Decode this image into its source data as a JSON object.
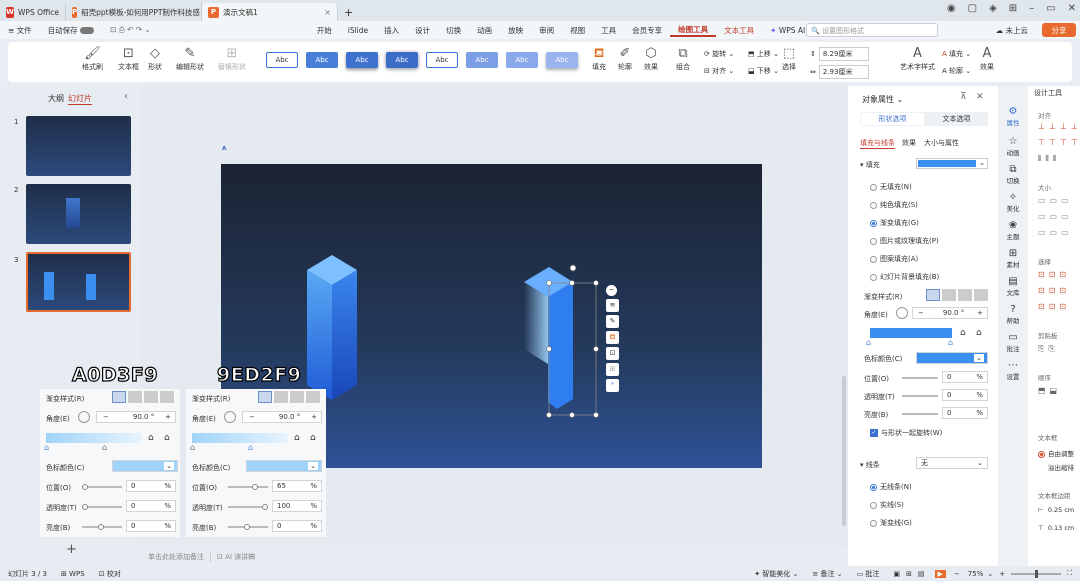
{
  "titlebar": {
    "tabs": [
      {
        "label": "WPS Office",
        "logo": "W",
        "color": "#d9342b"
      },
      {
        "label": "稻壳ppt模板-如何用PPT制作科技感",
        "logo": "P",
        "color": "#e86a2e"
      },
      {
        "label": "演示文稿1",
        "logo": "P",
        "color": "#e86a2e"
      }
    ],
    "new_tab": "+"
  },
  "menubar": {
    "file": "文件",
    "autosave": "自动保存",
    "items": [
      "开始",
      "iSlide",
      "插入",
      "设计",
      "切换",
      "动画",
      "放映",
      "审阅",
      "视图",
      "工具",
      "会员专享"
    ],
    "drawing_tools": "绘图工具",
    "text_tools": "文本工具",
    "wps_ai": "WPS AI",
    "search_placeholder": "设置图形格式",
    "cloud": "未上云",
    "share": "分享"
  },
  "ribbon": {
    "format_brush": "格式刷",
    "textbox": "文本框",
    "shape": "形状",
    "edit_shape": "编辑形状",
    "replace_shape": "替换形状",
    "style_label": "Abc",
    "fill": "填充",
    "outline": "轮廓",
    "effect": "效果",
    "combine": "组合",
    "rotate": "旋转",
    "align": "对齐",
    "up": "上移",
    "down": "下移",
    "select": "选择",
    "height": "8.29厘米",
    "width": "2.93厘米",
    "art_text": "艺术字样式",
    "text_fill": "填充",
    "text_outline": "轮廓",
    "text_effect": "效果"
  },
  "leftpanel": {
    "outline": "大纲",
    "slides": "幻灯片",
    "nums": [
      "1",
      "2",
      "3"
    ],
    "add": "+"
  },
  "notes_placeholder": "单击此处添加备注",
  "ai_notes": "AI 演讲稿",
  "overlay_left": {
    "hex": "A0D3F9",
    "gradient_style": "渐变样式(R)",
    "angle": "角度(E)",
    "angle_value": "90.0",
    "deg": "°",
    "color": "色标颜色(C)",
    "position": "位置(O)",
    "position_value": "0",
    "transparency": "透明度(T)",
    "transparency_value": "0",
    "brightness": "亮度(B)",
    "brightness_value": "0",
    "pct": "%",
    "swatch": "#a0d3f9"
  },
  "overlay_right": {
    "hex": "9ED2F9",
    "gradient_style": "渐变样式(R)",
    "angle": "角度(E)",
    "angle_value": "90.0",
    "deg": "°",
    "color": "色标颜色(C)",
    "position": "位置(O)",
    "position_value": "65",
    "transparency": "透明度(T)",
    "transparency_value": "100",
    "brightness": "亮度(B)",
    "brightness_value": "0",
    "pct": "%",
    "swatch": "#9ed2f9"
  },
  "rightpanel": {
    "title": "对象属性",
    "tab_shape": "形状选项",
    "tab_text": "文本选项",
    "sub_fill_line": "填充与线条",
    "sub_effect": "效果",
    "sub_size": "大小与属性",
    "fill_section": "填充",
    "fill_options": [
      "无填充(N)",
      "纯色填充(S)",
      "渐变填充(G)",
      "图片或纹理填充(P)",
      "图案填充(A)",
      "幻灯片背景填充(B)"
    ],
    "fill_selected": 2,
    "gradient_style": "渐变样式(R)",
    "angle": "角度(E)",
    "angle_value": "90.0",
    "deg": "°",
    "stop_color": "色标颜色(C)",
    "position": "位置(O)",
    "position_value": "0",
    "transparency": "透明度(T)",
    "transparency_value": "0",
    "brightness": "亮度(B)",
    "brightness_value": "0",
    "pct": "%",
    "rotate_with_shape": "与形状一起旋转(W)",
    "line_section": "线条",
    "line_value": "无",
    "line_options": [
      "无线条(N)",
      "实线(S)",
      "渐变线(G)"
    ],
    "line_selected": 0,
    "fill_color": "#3b8ff0"
  },
  "sidebar": [
    "属性",
    "动画",
    "切换",
    "美化",
    "主题",
    "素材",
    "文库",
    "帮助",
    "批注",
    "设置"
  ],
  "farright": {
    "title": "设计工具",
    "align": "对齐",
    "size": "大小",
    "select": "选择",
    "clipboard": "剪贴板",
    "order": "顺序",
    "textbox": "文本框",
    "autofit": "自由调整",
    "overflow": "溢出缩排",
    "margin": "文本框边距",
    "margin1": "0.25 cm",
    "margin2": "0.13 cm"
  },
  "statusbar": {
    "slide": "幻灯片 3 / 3",
    "wps": "WPS",
    "proof": "校对",
    "beautify": "智能美化",
    "notes": "备注",
    "comments": "批注",
    "zoom": "75%",
    "zoom_minus": "−",
    "zoom_plus": "+"
  }
}
